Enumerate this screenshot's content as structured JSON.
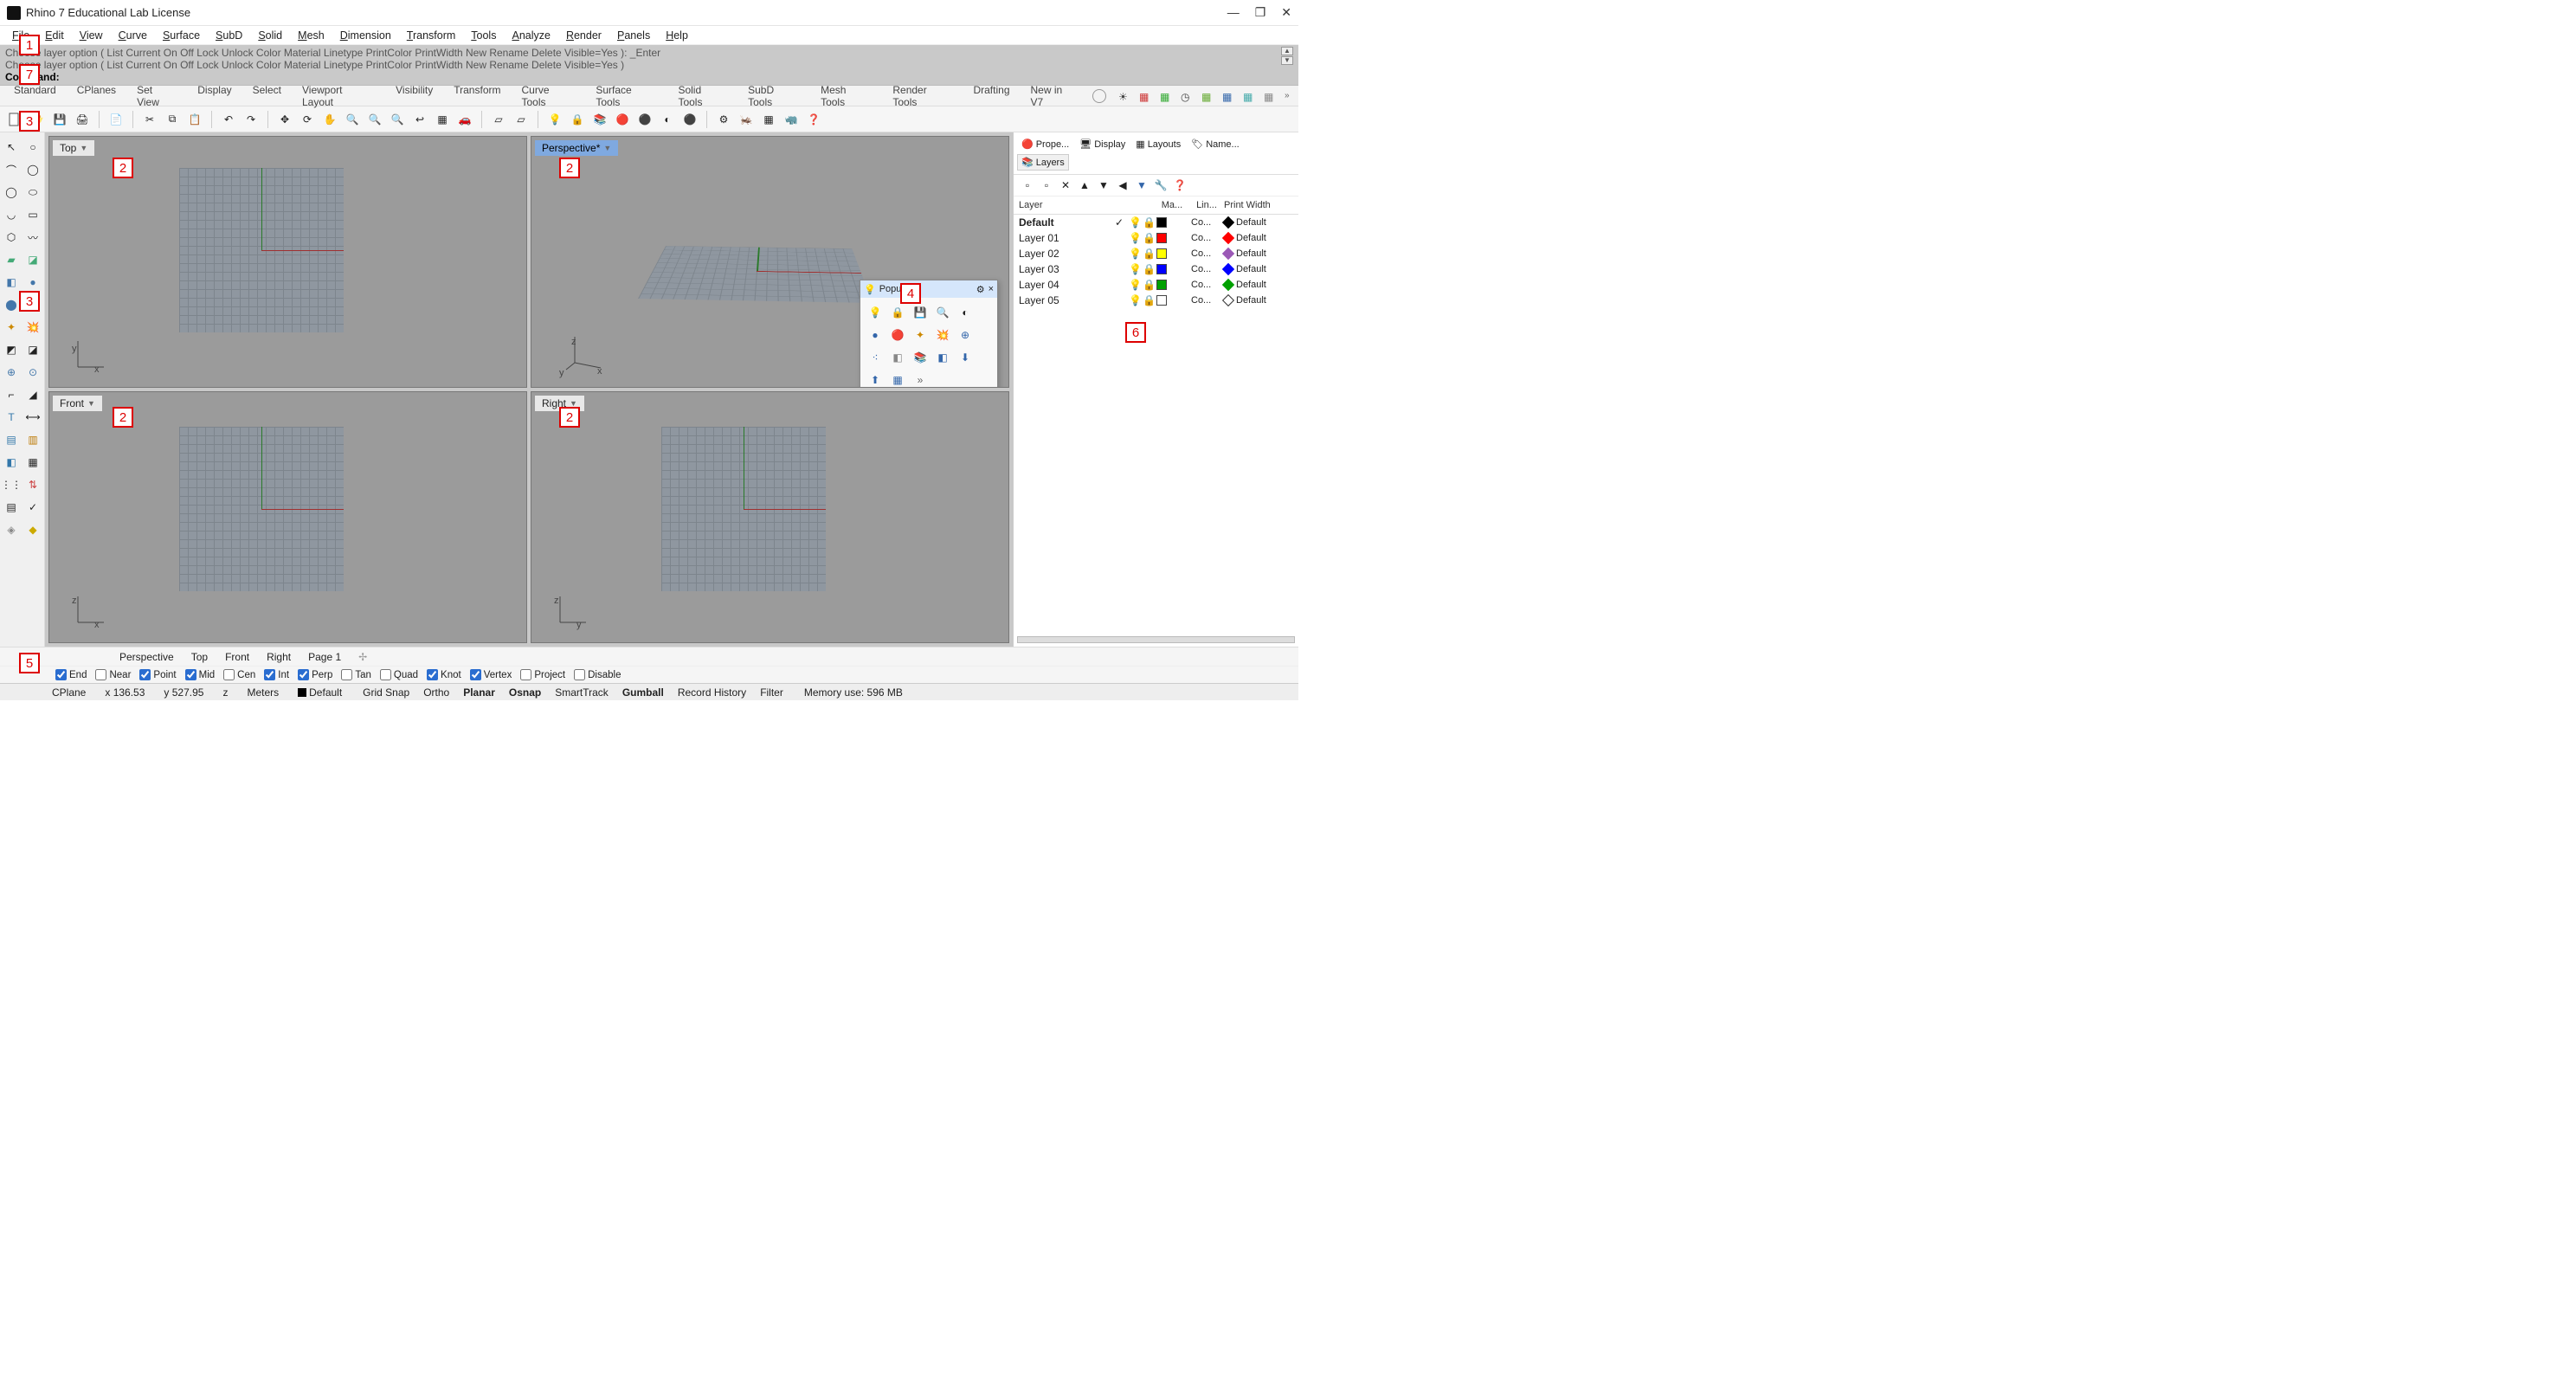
{
  "app": {
    "title": "Rhino 7 Educational Lab License"
  },
  "menu": [
    "File",
    "Edit",
    "View",
    "Curve",
    "Surface",
    "SubD",
    "Solid",
    "Mesh",
    "Dimension",
    "Transform",
    "Tools",
    "Analyze",
    "Render",
    "Panels",
    "Help"
  ],
  "cmd": {
    "line1": "Choose layer option ( List  Current  On  Off  Lock  Unlock  Color  Material  Linetype  PrintColor  PrintWidth  New  Rename  Delete  Visible=Yes ): _Enter",
    "line2": "Choose layer option ( List  Current  On  Off  Lock  Unlock  Color  Material  Linetype  PrintColor  PrintWidth  New  Rename  Delete  Visible=Yes )",
    "prompt": "Command:"
  },
  "tooltabs": [
    "Standard",
    "CPlanes",
    "Set View",
    "Display",
    "Select",
    "Viewport Layout",
    "Visibility",
    "Transform",
    "Curve Tools",
    "Surface Tools",
    "Solid Tools",
    "SubD Tools",
    "Mesh Tools",
    "Render Tools",
    "Drafting",
    "New in V7"
  ],
  "viewports": {
    "top": "Top",
    "perspective": "Perspective*",
    "front": "Front",
    "right": "Right"
  },
  "popup": {
    "title": "Popup"
  },
  "panel": {
    "tabs": [
      "Prope...",
      "Display",
      "Layouts",
      "Name...",
      "Layers"
    ],
    "headers": {
      "layer": "Layer",
      "ma": "Ma...",
      "lin": "Lin...",
      "pw": "Print Width"
    },
    "layers": [
      {
        "name": "Default",
        "current": true,
        "color": "#000000",
        "lin": "Co...",
        "diamond": "#000000",
        "pw": "Default",
        "bold": true
      },
      {
        "name": "Layer 01",
        "current": false,
        "color": "#ff0000",
        "lin": "Co...",
        "diamond": "#ff0000",
        "pw": "Default",
        "bold": false
      },
      {
        "name": "Layer 02",
        "current": false,
        "color": "#ffff00",
        "lin": "Co...",
        "diamond": "#9b59b6",
        "pw": "Default",
        "bold": false
      },
      {
        "name": "Layer 03",
        "current": false,
        "color": "#0000ff",
        "lin": "Co...",
        "diamond": "#0000ff",
        "pw": "Default",
        "bold": false
      },
      {
        "name": "Layer 04",
        "current": false,
        "color": "#00a000",
        "lin": "Co...",
        "diamond": "#00a000",
        "pw": "Default",
        "bold": false
      },
      {
        "name": "Layer 05",
        "current": false,
        "color": "#ffffff",
        "lin": "Co...",
        "diamond": "#ffffff",
        "pw": "Default",
        "bold": false
      }
    ]
  },
  "viewtabs": [
    "Perspective",
    "Top",
    "Front",
    "Right",
    "Page 1"
  ],
  "osnap": [
    {
      "label": "End",
      "on": true
    },
    {
      "label": "Near",
      "on": false
    },
    {
      "label": "Point",
      "on": true
    },
    {
      "label": "Mid",
      "on": true
    },
    {
      "label": "Cen",
      "on": false
    },
    {
      "label": "Int",
      "on": true
    },
    {
      "label": "Perp",
      "on": true
    },
    {
      "label": "Tan",
      "on": false
    },
    {
      "label": "Quad",
      "on": false
    },
    {
      "label": "Knot",
      "on": true
    },
    {
      "label": "Vertex",
      "on": true
    },
    {
      "label": "Project",
      "on": false
    },
    {
      "label": "Disable",
      "on": false
    }
  ],
  "status": {
    "cplane": "CPlane",
    "x": "x 136.53",
    "y": "y 527.95",
    "z": "z",
    "units": "Meters",
    "layer": "Default",
    "toggles": [
      {
        "label": "Grid Snap",
        "bold": false
      },
      {
        "label": "Ortho",
        "bold": false
      },
      {
        "label": "Planar",
        "bold": true
      },
      {
        "label": "Osnap",
        "bold": true
      },
      {
        "label": "SmartTrack",
        "bold": false
      },
      {
        "label": "Gumball",
        "bold": true
      },
      {
        "label": "Record History",
        "bold": false
      },
      {
        "label": "Filter",
        "bold": false
      }
    ],
    "mem": "Memory use: 596 MB"
  },
  "callouts": {
    "c1": "1",
    "c2": "2",
    "c3": "3",
    "c4": "4",
    "c5": "5",
    "c6": "6",
    "c7": "7"
  }
}
